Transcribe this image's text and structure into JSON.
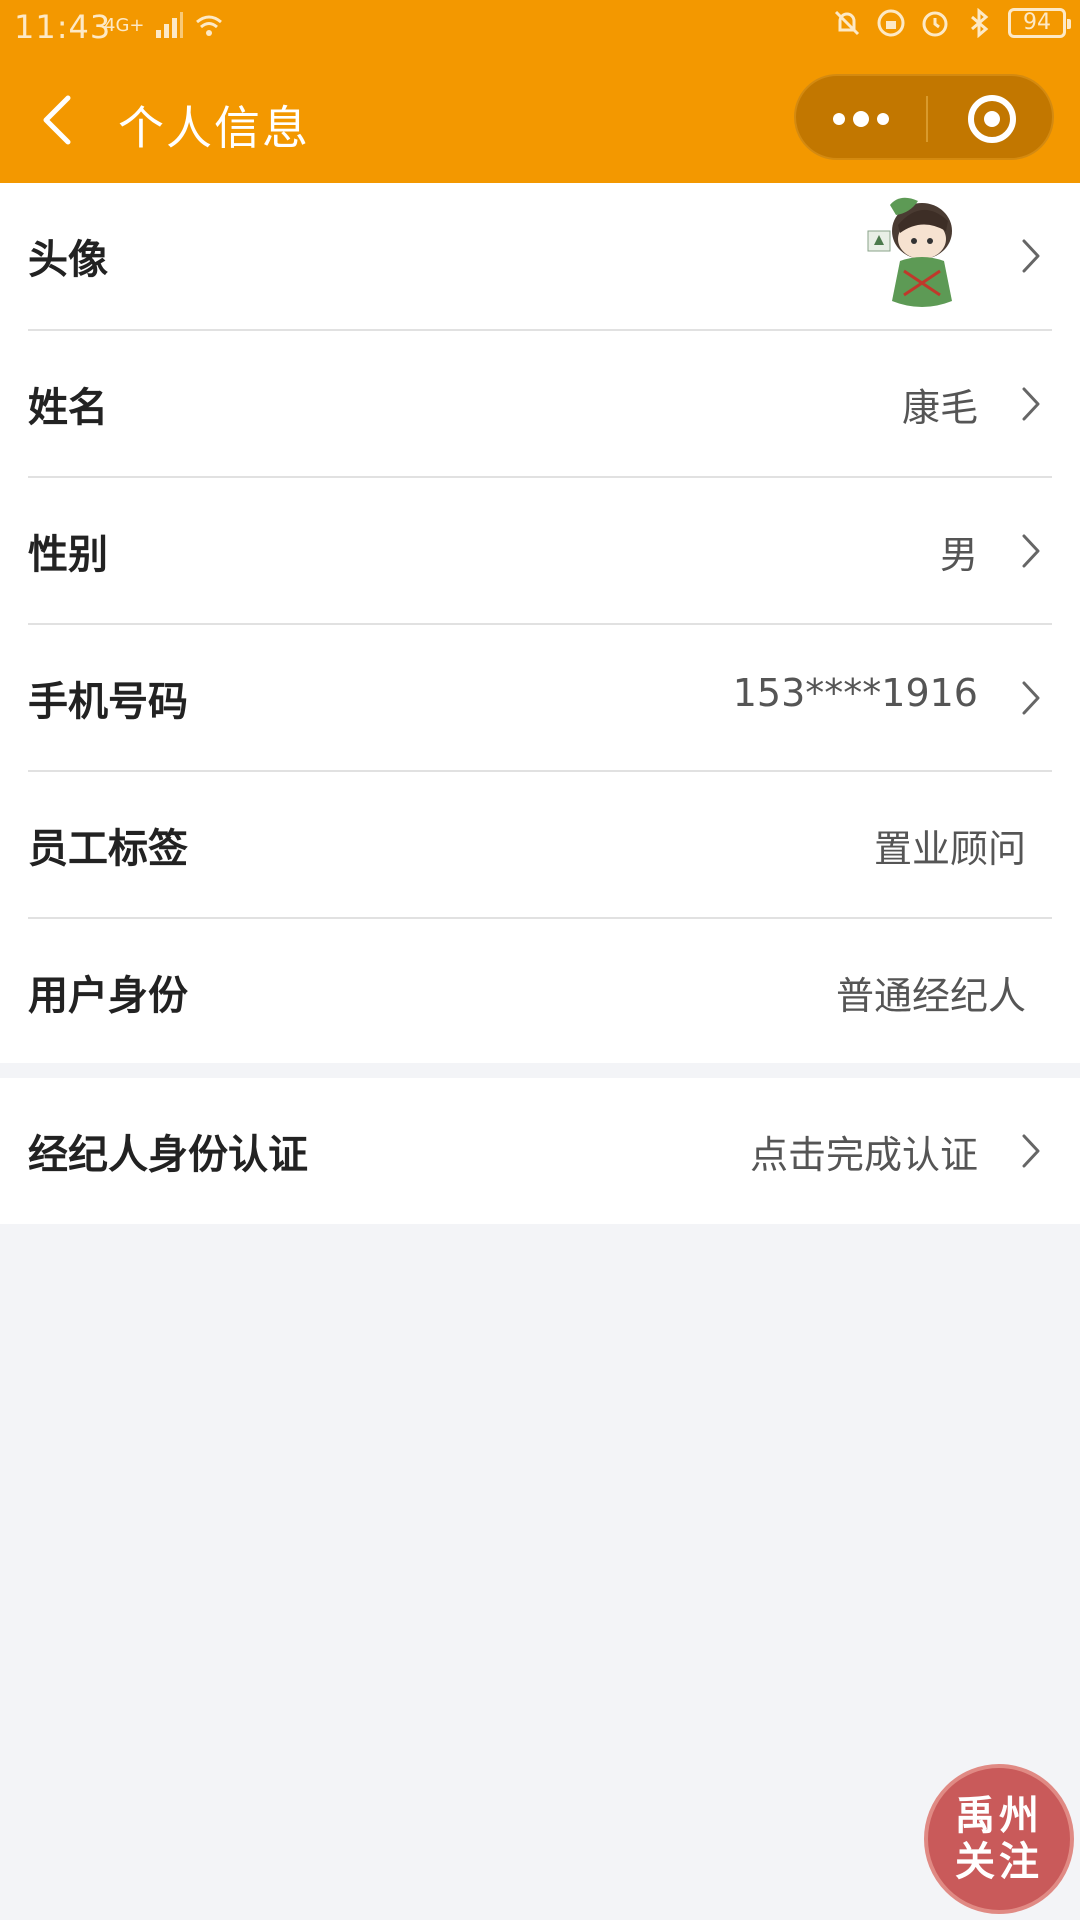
{
  "status_bar": {
    "time": "11:43",
    "network": "4G+",
    "battery": "94"
  },
  "header": {
    "title": "个人信息",
    "back_icon": "chevron-left-icon",
    "more_icon": "more-dots-icon",
    "close_icon": "target-circle-icon"
  },
  "profile_rows": [
    {
      "label": "头像",
      "value": "",
      "has_arrow": true
    },
    {
      "label": "姓名",
      "value": "康毛",
      "has_arrow": true
    },
    {
      "label": "性别",
      "value": "男",
      "has_arrow": true
    },
    {
      "label": "手机号码",
      "value": "153****1916",
      "has_arrow": true
    },
    {
      "label": "员工标签",
      "value": "置业顾问",
      "has_arrow": false
    },
    {
      "label": "用户身份",
      "value": "普通经纪人",
      "has_arrow": false
    }
  ],
  "certification": {
    "label": "经纪人身份认证",
    "value": "点击完成认证",
    "has_arrow": true
  },
  "floating_badge": {
    "line1": "禹州",
    "line2": "关注"
  },
  "colors": {
    "header": "#f39800",
    "capsule": "#c27700",
    "badge": "#c95a5a",
    "background": "#f3f4f7"
  }
}
